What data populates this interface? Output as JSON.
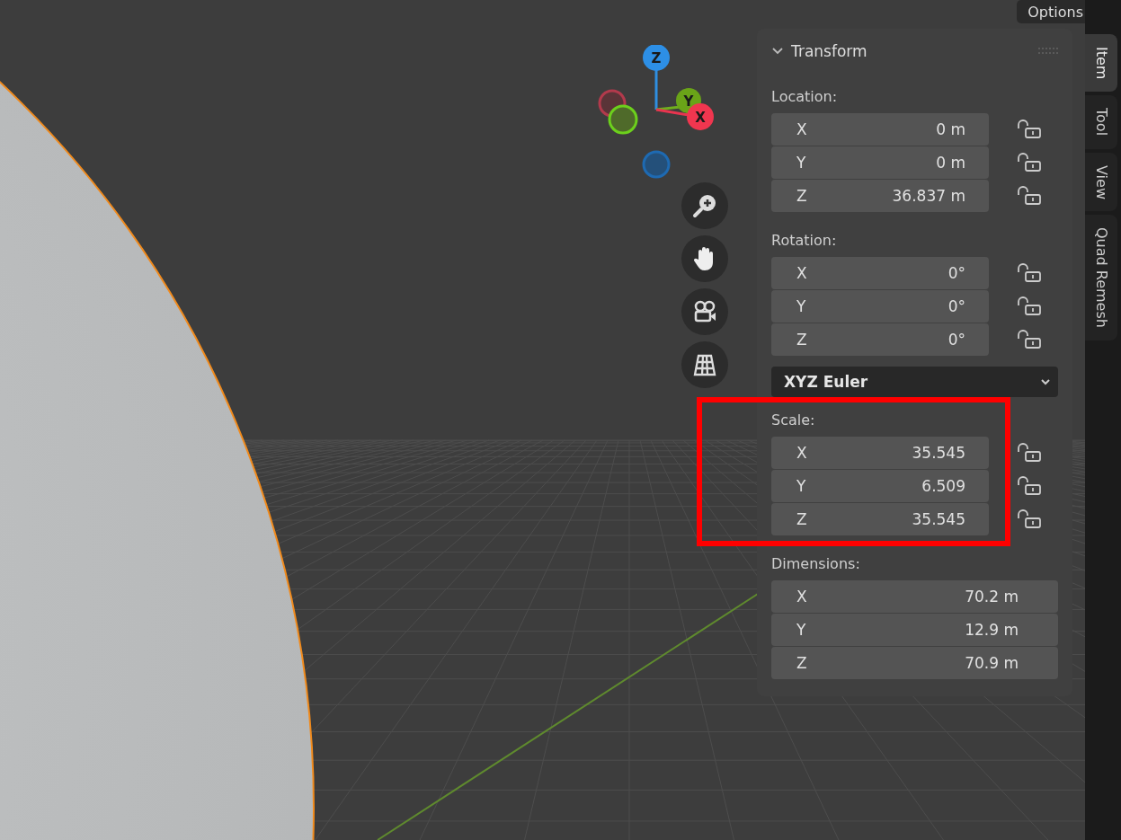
{
  "header": {
    "options_label": "Options"
  },
  "gizmo": {
    "x": "X",
    "y": "Y",
    "z": "Z"
  },
  "transform": {
    "title": "Transform",
    "expanded": true,
    "sections": [
      {
        "kind": "vector",
        "label": "Location:",
        "fields": [
          {
            "axis": "X",
            "value": "0 m",
            "locked": false
          },
          {
            "axis": "Y",
            "value": "0 m",
            "locked": false
          },
          {
            "axis": "Z",
            "value": "36.837 m",
            "locked": false
          }
        ]
      },
      {
        "kind": "vector",
        "label": "Rotation:",
        "fields": [
          {
            "axis": "X",
            "value": "0°",
            "locked": false
          },
          {
            "axis": "Y",
            "value": "0°",
            "locked": false
          },
          {
            "axis": "Z",
            "value": "0°",
            "locked": false
          }
        ]
      },
      {
        "kind": "dropdown",
        "value": "XYZ Euler"
      },
      {
        "kind": "vector",
        "label": "Scale:",
        "highlighted": true,
        "fields": [
          {
            "axis": "X",
            "value": "35.545",
            "locked": false
          },
          {
            "axis": "Y",
            "value": "6.509",
            "locked": false
          },
          {
            "axis": "Z",
            "value": "35.545",
            "locked": false
          }
        ]
      },
      {
        "kind": "vector",
        "label": "Dimensions:",
        "fields": [
          {
            "axis": "X",
            "value": "70.2 m"
          },
          {
            "axis": "Y",
            "value": "12.9 m"
          },
          {
            "axis": "Z",
            "value": "70.9 m"
          }
        ]
      }
    ]
  },
  "tabs": [
    {
      "label": "Item",
      "selected": true
    },
    {
      "label": "Tool",
      "selected": false
    },
    {
      "label": "View",
      "selected": false
    },
    {
      "label": "Quad Remesh",
      "selected": false
    }
  ]
}
